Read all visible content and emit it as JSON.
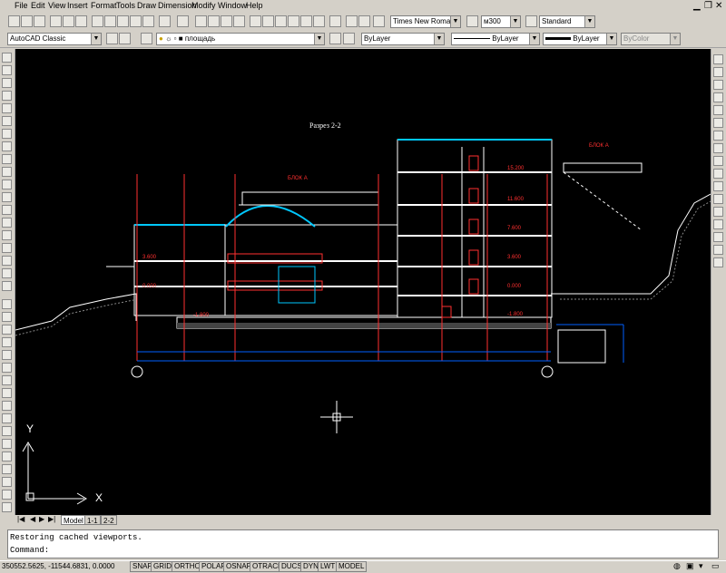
{
  "menu": {
    "items": [
      "File",
      "Edit",
      "View",
      "Insert",
      "Format",
      "Tools",
      "Draw",
      "Dimension",
      "Modify",
      "Window",
      "Help"
    ]
  },
  "toolbar": {
    "text_font": "Times New Roman",
    "text_height": "м300",
    "text_style": "Standard",
    "workspace": "AutoCAD Classic",
    "layer_name": "площадь",
    "color": "ByLayer",
    "linetype": "ByLayer",
    "lineweight": "ByLayer",
    "plotstyle": "ByColor"
  },
  "drawing": {
    "title": "Разрез 2-2",
    "block_label_a": "БЛОК А",
    "block_label_b": "БЛОК А",
    "elev_right": [
      "15.200",
      "11.600",
      "7.600",
      "3.600",
      "0.000",
      "-1.800"
    ],
    "elev_left": [
      "3.600",
      "0.000",
      "-1.800"
    ],
    "ucs_y": "Y",
    "ucs_x": "X"
  },
  "tabs": [
    "Model",
    "1-1",
    "2-2"
  ],
  "command": {
    "history": "Restoring cached viewports.",
    "prompt": "Command:"
  },
  "status": {
    "coords": "350552.5625, -11544.6831, 0.0000",
    "buttons": [
      "SNAP",
      "GRID",
      "ORTHO",
      "POLAR",
      "OSNAP",
      "OTRACK",
      "DUCS",
      "DYN",
      "LWT",
      "MODEL"
    ]
  }
}
